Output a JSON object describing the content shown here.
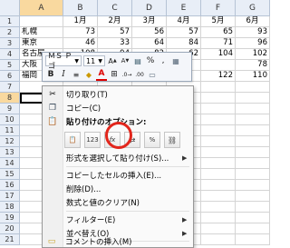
{
  "sheet": {
    "columns": [
      "A",
      "B",
      "C",
      "D",
      "E",
      "F",
      "G"
    ],
    "header_row": [
      "",
      "1月",
      "2月",
      "3月",
      "4月",
      "5月",
      "6月"
    ],
    "rows": [
      {
        "num": "1",
        "cells": [
          "",
          "1月",
          "2月",
          "3月",
          "4月",
          "5月",
          "6月"
        ]
      },
      {
        "num": "2",
        "cells": [
          "札幌",
          "73",
          "57",
          "56",
          "57",
          "65",
          "93"
        ]
      },
      {
        "num": "3",
        "cells": [
          "東京",
          "46",
          "33",
          "64",
          "84",
          "71",
          "96"
        ]
      },
      {
        "num": "4",
        "cells": [
          "名古屋",
          "108",
          "94",
          "82",
          "62",
          "104",
          "102"
        ]
      },
      {
        "num": "5",
        "cells": [
          "大阪",
          "",
          "",
          "",
          "",
          "",
          "78"
        ]
      },
      {
        "num": "6",
        "cells": [
          "福岡",
          "",
          "",
          "",
          "",
          "122",
          "110"
        ]
      },
      {
        "num": "7",
        "cells": []
      },
      {
        "num": "8",
        "cells": []
      },
      {
        "num": "9",
        "cells": []
      },
      {
        "num": "10",
        "cells": []
      },
      {
        "num": "11",
        "cells": []
      },
      {
        "num": "12",
        "cells": []
      },
      {
        "num": "13",
        "cells": []
      },
      {
        "num": "14",
        "cells": []
      },
      {
        "num": "15",
        "cells": []
      },
      {
        "num": "16",
        "cells": []
      },
      {
        "num": "17",
        "cells": []
      },
      {
        "num": "18",
        "cells": []
      },
      {
        "num": "19",
        "cells": []
      },
      {
        "num": "20",
        "cells": []
      },
      {
        "num": "21",
        "cells": []
      }
    ]
  },
  "mini_toolbar": {
    "font_name": "ＭＳ Ｐゴ",
    "font_size": "11",
    "bold": "B",
    "italic": "I",
    "font_color_letter": "A",
    "percent": "%",
    "comma": ","
  },
  "menu": {
    "cut": "切り取り(T)",
    "copy": "コピー(C)",
    "paste_options": "貼り付けのオプション:",
    "paste_special": "形式を選択して貼り付け(S)...",
    "insert_copied": "コピーしたセルの挿入(E)...",
    "delete": "削除(D)...",
    "clear": "数式と値のクリア(N)",
    "filter": "フィルター(E)",
    "sort": "並べ替え(O)",
    "insert_comment": "コメントの挿入(M)",
    "paste_values_label": "123",
    "paste_formula_label": "fx"
  },
  "colors": {
    "highlight_circle": "#e2261c",
    "header_bg": "#e8eef7",
    "selected_header_bg": "#f9d99f"
  }
}
